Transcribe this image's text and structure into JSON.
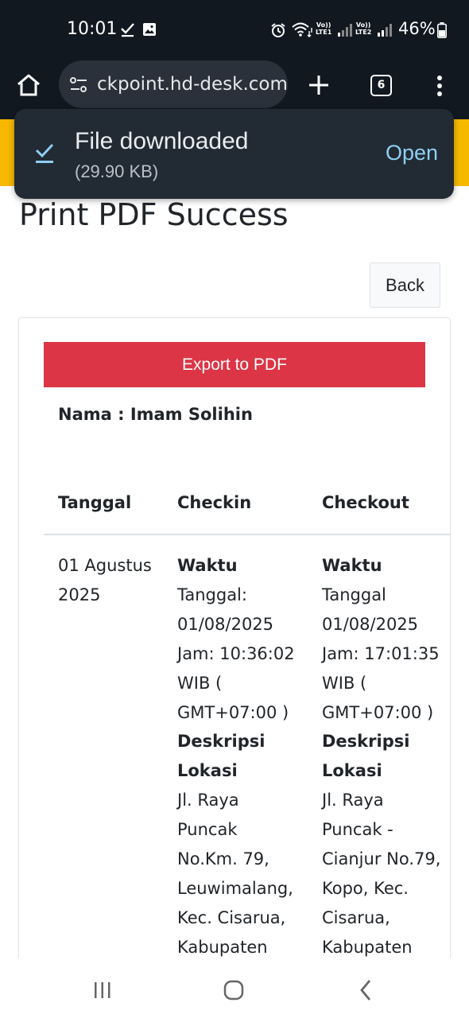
{
  "status_bar": {
    "time": "10:01",
    "battery": "46%",
    "lte1": "Vo))\nLTE1",
    "lte2": "Vo))\nLTE2"
  },
  "browser": {
    "url": "ckpoint.hd-desk.com",
    "tab_count": "6"
  },
  "toast": {
    "title": "File downloaded",
    "size": "(29.90 KB)",
    "action": "Open"
  },
  "page": {
    "title": "Print PDF Success",
    "back_label": "Back",
    "export_label": "Export to PDF",
    "nama_label": "Nama : Imam Solihin"
  },
  "table": {
    "headers": [
      "Tanggal",
      "Checkin",
      "Checkout"
    ],
    "row": {
      "tanggal": [
        "01 Agustus",
        "2025"
      ],
      "checkin": {
        "waktu_label": "Waktu",
        "waktu_lines": [
          "Tanggal:",
          "01/08/2025",
          "Jam: 10:36:02",
          "WIB (",
          "GMT+07:00 )"
        ],
        "lokasi_label": [
          "Deskripsi",
          "Lokasi"
        ],
        "lokasi_lines": [
          "Jl. Raya",
          "Puncak",
          "No.Km. 79,",
          "Leuwimalang,",
          "Kec. Cisarua,",
          "Kabupaten"
        ]
      },
      "checkout": {
        "waktu_label": "Waktu",
        "waktu_lines": [
          "Tanggal",
          "01/08/2025",
          "Jam: 17:01:35",
          "WIB (",
          "GMT+07:00 )"
        ],
        "lokasi_label": [
          "Deskripsi",
          "Lokasi"
        ],
        "lokasi_lines": [
          "Jl. Raya",
          "Puncak -",
          "Cianjur No.79,",
          "Kopo, Kec.",
          "Cisarua,",
          "Kabupaten"
        ]
      }
    }
  },
  "icons": {
    "home": "home-icon",
    "site_settings": "site-settings-icon",
    "new_tab": "plus-icon",
    "menu": "more-vert-icon",
    "download_done": "download-check-icon",
    "recents": "recents-icon",
    "home_nav": "home-nav-icon",
    "back_nav": "back-nav-icon"
  },
  "colors": {
    "chrome_bg": "#121820",
    "toast_bg": "#222a33",
    "toast_action": "#8fcff4",
    "brand_yellow": "#f7b800",
    "export_red": "#dc3545"
  }
}
